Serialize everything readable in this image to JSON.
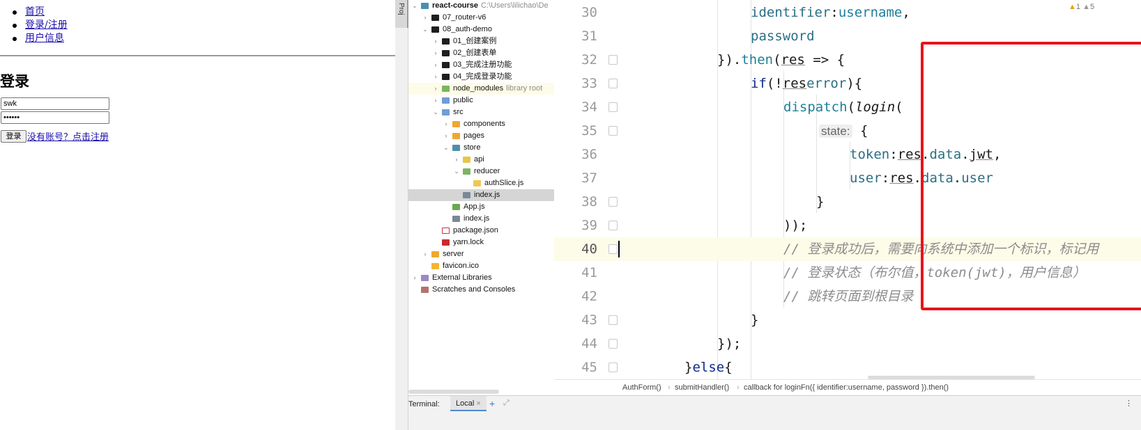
{
  "browser": {
    "nav": [
      "首页",
      "登录/注册",
      "用户信息"
    ],
    "heading": "登录",
    "username_value": "swk",
    "password_value": "••••••",
    "login_button": "登录",
    "register_link": "没有账号？点击注册"
  },
  "ide": {
    "side_tab": "Proj",
    "tree": [
      {
        "depth": 0,
        "chev": "v",
        "icon": "fld-teal",
        "label": "react-course",
        "extra": "C:\\Users\\lilichao\\De",
        "bold": true
      },
      {
        "depth": 1,
        "chev": ">",
        "icon": "fld-black",
        "label": "07_router-v6"
      },
      {
        "depth": 1,
        "chev": "v",
        "icon": "fld-black",
        "label": "08_auth-demo"
      },
      {
        "depth": 2,
        "chev": ">",
        "icon": "fld-black",
        "label": "01_创建案例"
      },
      {
        "depth": 2,
        "chev": ">",
        "icon": "fld-black",
        "label": "02_创建表单"
      },
      {
        "depth": 2,
        "chev": ">",
        "icon": "fld-black",
        "label": "03_完成注册功能"
      },
      {
        "depth": 2,
        "chev": ">",
        "icon": "fld-black",
        "label": "04_完成登录功能"
      },
      {
        "depth": 2,
        "chev": ">",
        "icon": "fld-green",
        "label": "node_modules",
        "extra": "library root",
        "hl": true
      },
      {
        "depth": 2,
        "chev": ">",
        "icon": "fld-blue",
        "label": "public"
      },
      {
        "depth": 2,
        "chev": "v",
        "icon": "fld-blue",
        "label": "src"
      },
      {
        "depth": 3,
        "chev": ">",
        "icon": "fld-orange",
        "label": "components"
      },
      {
        "depth": 3,
        "chev": ">",
        "icon": "fld-orange",
        "label": "pages"
      },
      {
        "depth": 3,
        "chev": "v",
        "icon": "fld-teal",
        "label": "store"
      },
      {
        "depth": 4,
        "chev": ">",
        "icon": "fld-yellow",
        "label": "api"
      },
      {
        "depth": 4,
        "chev": "v",
        "icon": "fld-green",
        "label": "reducer"
      },
      {
        "depth": 5,
        "chev": "",
        "icon": "file-js",
        "label": "authSlice.js"
      },
      {
        "depth": 4,
        "chev": "",
        "icon": "file-idx",
        "label": "index.js",
        "sel": true
      },
      {
        "depth": 3,
        "chev": "",
        "icon": "file-app",
        "label": "App.js"
      },
      {
        "depth": 3,
        "chev": "",
        "icon": "file-idx",
        "label": "index.js"
      },
      {
        "depth": 2,
        "chev": "",
        "icon": "file-json",
        "label": "package.json"
      },
      {
        "depth": 2,
        "chev": "",
        "icon": "file-lock",
        "label": "yarn.lock"
      },
      {
        "depth": 1,
        "chev": ">",
        "icon": "fld-orange",
        "label": "server"
      },
      {
        "depth": 1,
        "chev": "",
        "icon": "file-ico",
        "label": "favicon.ico"
      },
      {
        "depth": 0,
        "chev": ">",
        "icon": "file-lib",
        "label": "External Libraries"
      },
      {
        "depth": 0,
        "chev": "",
        "icon": "file-scr",
        "label": "Scratches and Consoles"
      }
    ],
    "line_numbers": [
      "30",
      "31",
      "32",
      "33",
      "34",
      "35",
      "36",
      "37",
      "38",
      "39",
      "40",
      "41",
      "42",
      "43",
      "44",
      "45"
    ],
    "code": {
      "l30": {
        "prop": "identifier",
        "sep": ":",
        "val": "username",
        "tail": ","
      },
      "l31": {
        "prop": "password"
      },
      "l32": {
        "a": "}).",
        "fn": "then",
        "b": "(",
        "var": "res",
        "c": " => {"
      },
      "l33": {
        "kw": "if",
        "a": "(!",
        "var": "res",
        ".": ".",
        "prop": "error",
        "c": "){"
      },
      "l34": {
        "fn": "dispatch",
        "a": "(",
        "it": "login",
        "c": "("
      },
      "l35": {
        "hint": "state:",
        "c": " {"
      },
      "l36": {
        "prop": "token",
        "sep": ":",
        "var": "res",
        "a": ".",
        "p2": "data",
        "b": ".",
        "p3": "jwt",
        "c": ","
      },
      "l37": {
        "prop": "user",
        "sep": ":",
        "var": "res",
        "a": ".",
        "p2": "data",
        "b": ".",
        "p3": "user"
      },
      "l38": {
        "c": "}"
      },
      "l39": {
        "c": "));"
      },
      "l40": {
        "cm": "// 登录成功后，需要向系统中添加一个标识，标记用"
      },
      "l41": {
        "cm": "// 登录状态（布尔值，token(jwt)，用户信息）"
      },
      "l42": {
        "cm": "// 跳转页面到根目录"
      },
      "l43": {
        "c": "}"
      },
      "l44": {
        "c": "});"
      },
      "l45": {
        "c": "}",
        "kw": "else",
        "d": "{"
      }
    },
    "warnings": {
      "warn_count": "1",
      "weak_count": "5"
    },
    "breadcrumb": [
      "AuthForm()",
      "submitHandler()",
      "callback for loginFn({ identifier:username, password }).then()"
    ],
    "bottom": {
      "terminal": "Terminal:",
      "local_tab": "Local",
      "plus": "+",
      "close": "×",
      "menu": "⋮"
    },
    "highlight_color": "#e8131d"
  }
}
